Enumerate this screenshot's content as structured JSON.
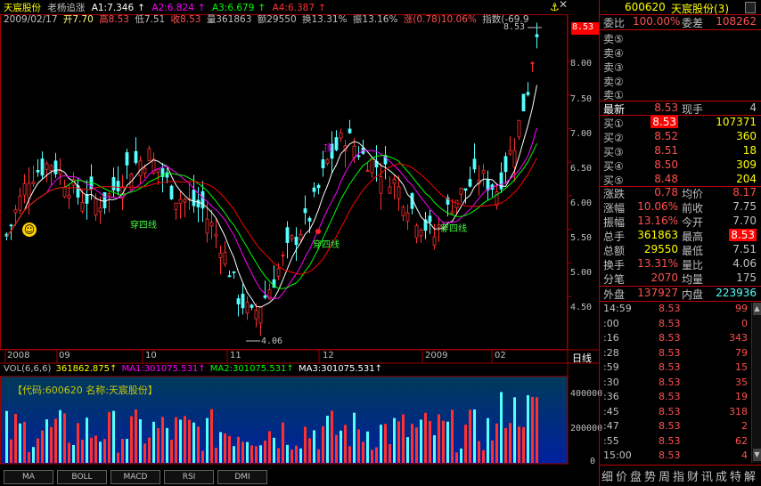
{
  "header": {
    "stock_name": "天宸股份",
    "formula": "老杨追涨",
    "a1": "A1:7.346",
    "a2": "A2:6.824",
    "a3": "A3:6.679",
    "a4": "A4:6.387",
    "arrow": "↑"
  },
  "info": {
    "date": "2009/02/17",
    "open": "开7.70",
    "high": "高8.53",
    "low": "低7.51",
    "close": "收8.53",
    "volume": "量361863",
    "amount": "额29550",
    "turnover": "换13.31%",
    "amplitude": "振13.16%",
    "change": "涨(0.78)10.06%",
    "index": "指数(-69.9"
  },
  "chart": {
    "price_labels": [
      "8.00",
      "7.50",
      "7.00",
      "6.50",
      "6.00",
      "5.50",
      "5.00",
      "4.50"
    ],
    "price_tag": "8.53",
    "high_mark": "8.53",
    "low_mark": "4.06",
    "annotations": [
      "穿四线",
      "穿四线",
      "穿四线"
    ],
    "peak_label": "顶",
    "month_labels": [
      "2008",
      "09",
      "10",
      "11",
      "12",
      "2009",
      "02"
    ],
    "period_label": "日线",
    "colors": {
      "up": "#ff3030",
      "down": "#54ffff",
      "ma_white": "#ffffff",
      "ma_yellow": "#ffff00",
      "ma_magenta": "#ff00ff",
      "ma_green": "#00ff00",
      "ma_red": "#ff0000"
    }
  },
  "volume": {
    "vol_label": "VOL(6,6,6)",
    "vol_value": "361862.875↑",
    "ma1": "MA1:301075.531↑",
    "ma2": "MA2:301075.531↑",
    "ma3": "MA3:301075.531↑",
    "code_text": "【代码:600620 名称:天宸股份】",
    "axis": [
      "400000",
      "200000",
      "0"
    ]
  },
  "tabs": [
    "MA",
    "BOLL",
    "MACD",
    "RSI",
    "DMI"
  ],
  "quote": {
    "code": "600620",
    "name": "天宸股份(3)",
    "weibi_label": "委比",
    "weibi": "100.00%",
    "weicha_label": "委差",
    "weicha": "108262",
    "sell": [
      "卖⑤",
      "卖④",
      "卖③",
      "卖②",
      "卖①"
    ],
    "latest_label": "最新",
    "latest": "8.53",
    "hand_label": "现手",
    "hand": "4",
    "buy": [
      {
        "label": "买①",
        "price": "8.53",
        "vol": "107371"
      },
      {
        "label": "买②",
        "price": "8.52",
        "vol": "360"
      },
      {
        "label": "买③",
        "price": "8.51",
        "vol": "18"
      },
      {
        "label": "买④",
        "price": "8.50",
        "vol": "309"
      },
      {
        "label": "买⑤",
        "price": "8.48",
        "vol": "204"
      }
    ],
    "stats": [
      {
        "l1": "涨跌",
        "v1": "0.78",
        "l2": "均价",
        "v2": "8.17"
      },
      {
        "l1": "涨幅",
        "v1": "10.06%",
        "l2": "前收",
        "v2": "7.75"
      },
      {
        "l1": "振幅",
        "v1": "13.16%",
        "l2": "今开",
        "v2": "7.70"
      },
      {
        "l1": "总手",
        "v1": "361863",
        "l2": "最高",
        "v2": "8.53"
      },
      {
        "l1": "总额",
        "v1": "29550",
        "l2": "最低",
        "v2": "7.51"
      },
      {
        "l1": "换手",
        "v1": "13.31%",
        "l2": "量比",
        "v2": "4.06"
      },
      {
        "l1": "分笔",
        "v1": "2070",
        "l2": "均量",
        "v2": "175"
      }
    ],
    "outer_label": "外盘",
    "outer": "137927",
    "inner_label": "内盘",
    "inner": "223936",
    "ticks": [
      {
        "t": "14:59",
        "p": "8.53",
        "v": "99"
      },
      {
        "t": ":00",
        "p": "8.53",
        "v": "0"
      },
      {
        "t": ":16",
        "p": "8.53",
        "v": "343"
      },
      {
        "t": ":28",
        "p": "8.53",
        "v": "79"
      },
      {
        "t": ":59",
        "p": "8.53",
        "v": "15"
      },
      {
        "t": ":30",
        "p": "8.53",
        "v": "35"
      },
      {
        "t": ":36",
        "p": "8.53",
        "v": "19"
      },
      {
        "t": ":45",
        "p": "8.53",
        "v": "318"
      },
      {
        "t": ":47",
        "p": "8.53",
        "v": "2"
      },
      {
        "t": ":55",
        "p": "8.53",
        "v": "62"
      },
      {
        "t": "15:00",
        "p": "8.53",
        "v": "4"
      }
    ],
    "footer_tabs": [
      "细",
      "价",
      "盘",
      "势",
      "周",
      "指",
      "财",
      "讯",
      "成",
      "特",
      "解"
    ]
  }
}
